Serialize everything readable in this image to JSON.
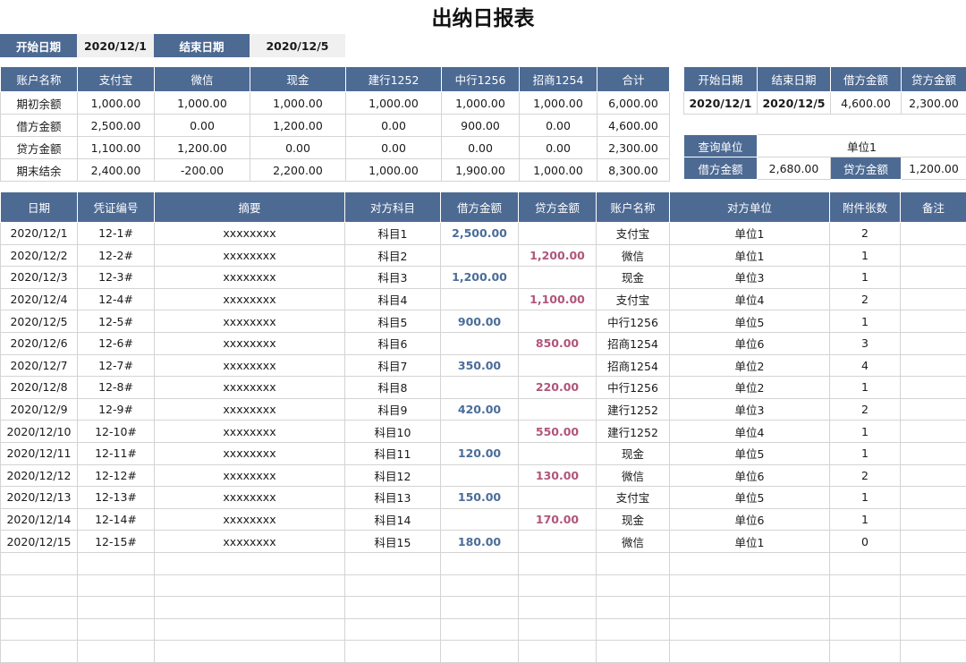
{
  "title": "出纳日报表",
  "date_bar": {
    "start_label": "开始日期",
    "start_value": "2020/12/1",
    "end_label": "结束日期",
    "end_value": "2020/12/5"
  },
  "summary": {
    "headers": [
      "账户名称",
      "支付宝",
      "微信",
      "现金",
      "建行1252",
      "中行1256",
      "招商1254",
      "合计"
    ],
    "rows": [
      [
        "期初余额",
        "1,000.00",
        "1,000.00",
        "1,000.00",
        "1,000.00",
        "1,000.00",
        "1,000.00",
        "6,000.00"
      ],
      [
        "借方金额",
        "2,500.00",
        "0.00",
        "1,200.00",
        "0.00",
        "900.00",
        "0.00",
        "4,600.00"
      ],
      [
        "贷方金额",
        "1,100.00",
        "1,200.00",
        "0.00",
        "0.00",
        "0.00",
        "0.00",
        "2,300.00"
      ],
      [
        "期末结余",
        "2,400.00",
        "-200.00",
        "2,200.00",
        "1,000.00",
        "1,900.00",
        "1,000.00",
        "8,300.00"
      ]
    ]
  },
  "period_summary": {
    "headers": [
      "开始日期",
      "结束日期",
      "借方金额",
      "贷方金额"
    ],
    "values": [
      "2020/12/1",
      "2020/12/5",
      "4,600.00",
      "2,300.00"
    ]
  },
  "query": {
    "unit_label": "查询单位",
    "unit_value": "单位1",
    "debit_label": "借方金额",
    "debit_value": "2,680.00",
    "credit_label": "贷方金额",
    "credit_value": "1,200.00"
  },
  "main": {
    "headers": [
      "日期",
      "凭证编号",
      "摘要",
      "对方科目",
      "借方金额",
      "贷方金额",
      "账户名称",
      "对方单位",
      "附件张数",
      "备注"
    ],
    "rows": [
      [
        "2020/12/1",
        "12-1#",
        "xxxxxxxx",
        "科目1",
        "2,500.00",
        "",
        "支付宝",
        "单位1",
        "2",
        ""
      ],
      [
        "2020/12/2",
        "12-2#",
        "xxxxxxxx",
        "科目2",
        "",
        "1,200.00",
        "微信",
        "单位1",
        "1",
        ""
      ],
      [
        "2020/12/3",
        "12-3#",
        "xxxxxxxx",
        "科目3",
        "1,200.00",
        "",
        "现金",
        "单位3",
        "1",
        ""
      ],
      [
        "2020/12/4",
        "12-4#",
        "xxxxxxxx",
        "科目4",
        "",
        "1,100.00",
        "支付宝",
        "单位4",
        "2",
        ""
      ],
      [
        "2020/12/5",
        "12-5#",
        "xxxxxxxx",
        "科目5",
        "900.00",
        "",
        "中行1256",
        "单位5",
        "1",
        ""
      ],
      [
        "2020/12/6",
        "12-6#",
        "xxxxxxxx",
        "科目6",
        "",
        "850.00",
        "招商1254",
        "单位6",
        "3",
        ""
      ],
      [
        "2020/12/7",
        "12-7#",
        "xxxxxxxx",
        "科目7",
        "350.00",
        "",
        "招商1254",
        "单位2",
        "4",
        ""
      ],
      [
        "2020/12/8",
        "12-8#",
        "xxxxxxxx",
        "科目8",
        "",
        "220.00",
        "中行1256",
        "单位2",
        "1",
        ""
      ],
      [
        "2020/12/9",
        "12-9#",
        "xxxxxxxx",
        "科目9",
        "420.00",
        "",
        "建行1252",
        "单位3",
        "2",
        ""
      ],
      [
        "2020/12/10",
        "12-10#",
        "xxxxxxxx",
        "科目10",
        "",
        "550.00",
        "建行1252",
        "单位4",
        "1",
        ""
      ],
      [
        "2020/12/11",
        "12-11#",
        "xxxxxxxx",
        "科目11",
        "120.00",
        "",
        "现金",
        "单位5",
        "1",
        ""
      ],
      [
        "2020/12/12",
        "12-12#",
        "xxxxxxxx",
        "科目12",
        "",
        "130.00",
        "微信",
        "单位6",
        "2",
        ""
      ],
      [
        "2020/12/13",
        "12-13#",
        "xxxxxxxx",
        "科目13",
        "150.00",
        "",
        "支付宝",
        "单位5",
        "1",
        ""
      ],
      [
        "2020/12/14",
        "12-14#",
        "xxxxxxxx",
        "科目14",
        "",
        "170.00",
        "现金",
        "单位6",
        "1",
        ""
      ],
      [
        "2020/12/15",
        "12-15#",
        "xxxxxxxx",
        "科目15",
        "180.00",
        "",
        "微信",
        "单位1",
        "0",
        ""
      ],
      [
        "",
        "",
        "",
        "",
        "",
        "",
        "",
        "",
        "",
        ""
      ],
      [
        "",
        "",
        "",
        "",
        "",
        "",
        "",
        "",
        "",
        ""
      ],
      [
        "",
        "",
        "",
        "",
        "",
        "",
        "",
        "",
        "",
        ""
      ],
      [
        "",
        "",
        "",
        "",
        "",
        "",
        "",
        "",
        "",
        ""
      ],
      [
        "",
        "",
        "",
        "",
        "",
        "",
        "",
        "",
        "",
        ""
      ]
    ]
  },
  "colors": {
    "header_bg": "#4d6a93",
    "debit_text": "#4a6d99",
    "credit_text": "#b1557a"
  }
}
